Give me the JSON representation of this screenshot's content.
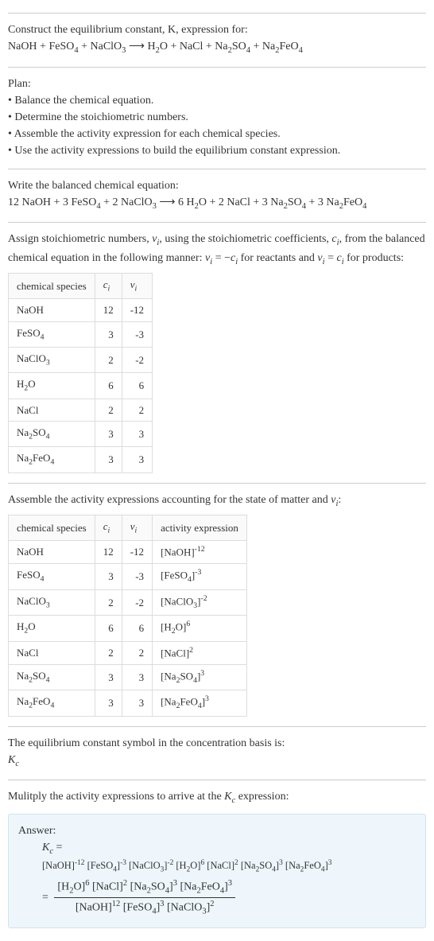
{
  "intro": {
    "line1": "Construct the equilibrium constant, K, expression for:",
    "line2_html": "NaOH + FeSO<sub>4</sub> + NaClO<sub>3</sub> ⟶ H<sub>2</sub>O + NaCl + Na<sub>2</sub>SO<sub>4</sub> + Na<sub>2</sub>FeO<sub>4</sub>"
  },
  "plan": {
    "heading": "Plan:",
    "items": [
      "• Balance the chemical equation.",
      "• Determine the stoichiometric numbers.",
      "• Assemble the activity expression for each chemical species.",
      "• Use the activity expressions to build the equilibrium constant expression."
    ]
  },
  "balanced": {
    "heading": "Write the balanced chemical equation:",
    "eq_html": "12 NaOH + 3 FeSO<sub>4</sub> + 2 NaClO<sub>3</sub> ⟶ 6 H<sub>2</sub>O + 2 NaCl + 3 Na<sub>2</sub>SO<sub>4</sub> + 3 Na<sub>2</sub>FeO<sub>4</sub>"
  },
  "stoich": {
    "text_html": "Assign stoichiometric numbers, <span class='italic'>ν<sub>i</sub></span>, using the stoichiometric coefficients, <span class='italic'>c<sub>i</sub></span>, from the balanced chemical equation in the following manner: <span class='italic'>ν<sub>i</sub></span> = −<span class='italic'>c<sub>i</sub></span> for reactants and <span class='italic'>ν<sub>i</sub></span> = <span class='italic'>c<sub>i</sub></span> for products:",
    "headers": [
      "chemical species",
      "c_i",
      "ν_i"
    ],
    "rows": [
      {
        "sp_html": "NaOH",
        "c": "12",
        "v": "-12"
      },
      {
        "sp_html": "FeSO<sub>4</sub>",
        "c": "3",
        "v": "-3"
      },
      {
        "sp_html": "NaClO<sub>3</sub>",
        "c": "2",
        "v": "-2"
      },
      {
        "sp_html": "H<sub>2</sub>O",
        "c": "6",
        "v": "6"
      },
      {
        "sp_html": "NaCl",
        "c": "2",
        "v": "2"
      },
      {
        "sp_html": "Na<sub>2</sub>SO<sub>4</sub>",
        "c": "3",
        "v": "3"
      },
      {
        "sp_html": "Na<sub>2</sub>FeO<sub>4</sub>",
        "c": "3",
        "v": "3"
      }
    ]
  },
  "activity": {
    "text_html": "Assemble the activity expressions accounting for the state of matter and <span class='italic'>ν<sub>i</sub></span>:",
    "headers": [
      "chemical species",
      "c_i",
      "ν_i",
      "activity expression"
    ],
    "rows": [
      {
        "sp_html": "NaOH",
        "c": "12",
        "v": "-12",
        "ae_html": "[NaOH]<sup>-12</sup>"
      },
      {
        "sp_html": "FeSO<sub>4</sub>",
        "c": "3",
        "v": "-3",
        "ae_html": "[FeSO<sub>4</sub>]<sup>-3</sup>"
      },
      {
        "sp_html": "NaClO<sub>3</sub>",
        "c": "2",
        "v": "-2",
        "ae_html": "[NaClO<sub>3</sub>]<sup>-2</sup>"
      },
      {
        "sp_html": "H<sub>2</sub>O",
        "c": "6",
        "v": "6",
        "ae_html": "[H<sub>2</sub>O]<sup>6</sup>"
      },
      {
        "sp_html": "NaCl",
        "c": "2",
        "v": "2",
        "ae_html": "[NaCl]<sup>2</sup>"
      },
      {
        "sp_html": "Na<sub>2</sub>SO<sub>4</sub>",
        "c": "3",
        "v": "3",
        "ae_html": "[Na<sub>2</sub>SO<sub>4</sub>]<sup>3</sup>"
      },
      {
        "sp_html": "Na<sub>2</sub>FeO<sub>4</sub>",
        "c": "3",
        "v": "3",
        "ae_html": "[Na<sub>2</sub>FeO<sub>4</sub>]<sup>3</sup>"
      }
    ]
  },
  "symbol": {
    "text": "The equilibrium constant symbol in the concentration basis is:",
    "kc_html": "<span class='italic'>K<sub>c</sub></span>"
  },
  "multiply": {
    "text_html": "Mulitply the activity expressions to arrive at the <span class='italic'>K<sub>c</sub></span> expression:"
  },
  "answer": {
    "label": "Answer:",
    "kc_html": "<span class='italic'>K<sub>c</sub></span> =",
    "line1_html": "[NaOH]<sup>-12</sup> [FeSO<sub>4</sub>]<sup>-3</sup> [NaClO<sub>3</sub>]<sup>-2</sup> [H<sub>2</sub>O]<sup>6</sup> [NaCl]<sup>2</sup> [Na<sub>2</sub>SO<sub>4</sub>]<sup>3</sup> [Na<sub>2</sub>FeO<sub>4</sub>]<sup>3</sup>",
    "frac_num_html": "[H<sub>2</sub>O]<sup>6</sup> [NaCl]<sup>2</sup> [Na<sub>2</sub>SO<sub>4</sub>]<sup>3</sup> [Na<sub>2</sub>FeO<sub>4</sub>]<sup>3</sup>",
    "frac_den_html": "[NaOH]<sup>12</sup> [FeSO<sub>4</sub>]<sup>3</sup> [NaClO<sub>3</sub>]<sup>2</sup>"
  }
}
